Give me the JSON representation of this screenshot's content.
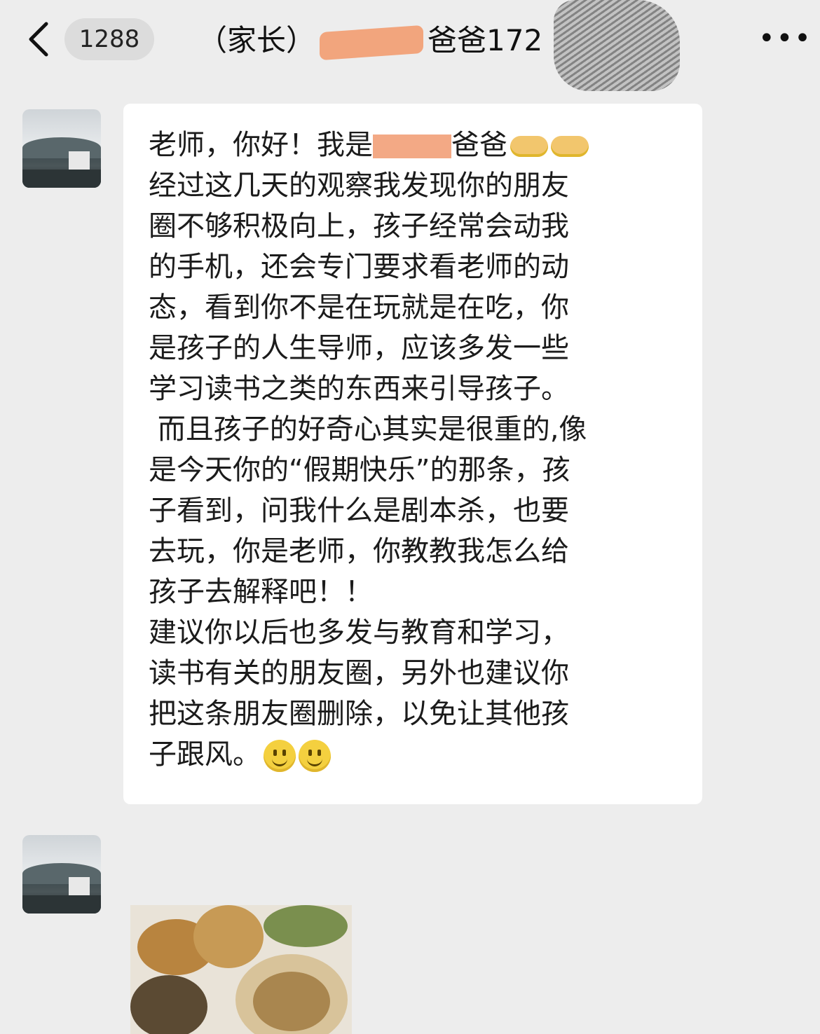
{
  "header": {
    "unread_count": "1288",
    "title_prefix": "（家长）",
    "title_suffix": "爸爸172",
    "more_label": "•••"
  },
  "message": {
    "lines": [
      "老师，你好！我是",
      "爸爸",
      "经过这几天的观察我发现你的朋友",
      "圈不够积极向上，孩子经常会动我",
      "的手机，还会专门要求看老师的动",
      "态，看到你不是在玩就是在吃，你",
      "是孩子的人生导师，应该多发一些",
      "学习读书之类的东西来引导孩子。",
      " 而且孩子的好奇心其实是很重的,像",
      "是今天你的“假期快乐”的那条，孩",
      "子看到，问我什么是剧本杀，也要",
      "去玩，你是老师，你教教我怎么给",
      "孩子去解释吧！！",
      "建议你以后也多发与教育和学习，",
      "读书有关的朋友圈，另外也建议你",
      "把这条朋友圈删除，以免让其他孩",
      "子跟风。"
    ],
    "emojis_line1": [
      "handshake-icon",
      "handshake-icon"
    ],
    "emojis_end": [
      "smile-icon",
      "smile-icon"
    ]
  },
  "colors": {
    "background": "#ededed",
    "bubble": "#ffffff",
    "redaction": "#f2a57d"
  }
}
